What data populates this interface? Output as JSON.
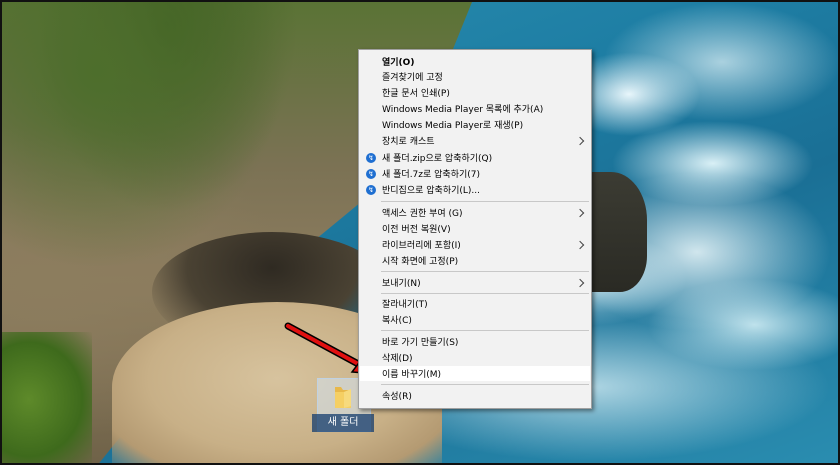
{
  "context_menu": {
    "items": [
      {
        "label": "열기(O)",
        "bold": true
      },
      {
        "label": "즐겨찾기에 고정"
      },
      {
        "label": "한글 문서 인쇄(P)"
      },
      {
        "label": "Windows Media Player 목록에 추가(A)"
      },
      {
        "label": "Windows Media Player로 재생(P)"
      },
      {
        "label": "장치로 캐스트",
        "submenu": true
      },
      {
        "label": "새 폴더.zip으로 압축하기(Q)",
        "icon": "bandizip-icon"
      },
      {
        "label": "새 폴더.7z로 압축하기(7)",
        "icon": "bandizip-icon"
      },
      {
        "label": "반디집으로 압축하기(L)...",
        "icon": "bandizip-icon"
      },
      {
        "label": "액세스 권한 부여 (G)",
        "submenu": true
      },
      {
        "label": "이전 버전 복원(V)"
      },
      {
        "label": "라이브러리에 포함(I)",
        "submenu": true
      },
      {
        "label": "시작 화면에 고정(P)"
      },
      {
        "label": "보내기(N)",
        "submenu": true
      },
      {
        "label": "잘라내기(T)"
      },
      {
        "label": "복사(C)"
      },
      {
        "label": "바로 가기 만들기(S)"
      },
      {
        "label": "삭제(D)"
      },
      {
        "label": "이름 바꾸기(M)",
        "highlighted": true
      },
      {
        "label": "속성(R)"
      }
    ]
  },
  "desktop": {
    "folder_label": "새 폴더",
    "folder_icon": "folder-icon"
  },
  "annotation": {
    "arrow_color": "#e01010",
    "arrow_icon": "red-arrow-icon"
  },
  "colors": {
    "menu_bg": "#f2f2f2",
    "highlight_bg": "#ffffff",
    "bandizip_blue": "#1f6fd1"
  }
}
